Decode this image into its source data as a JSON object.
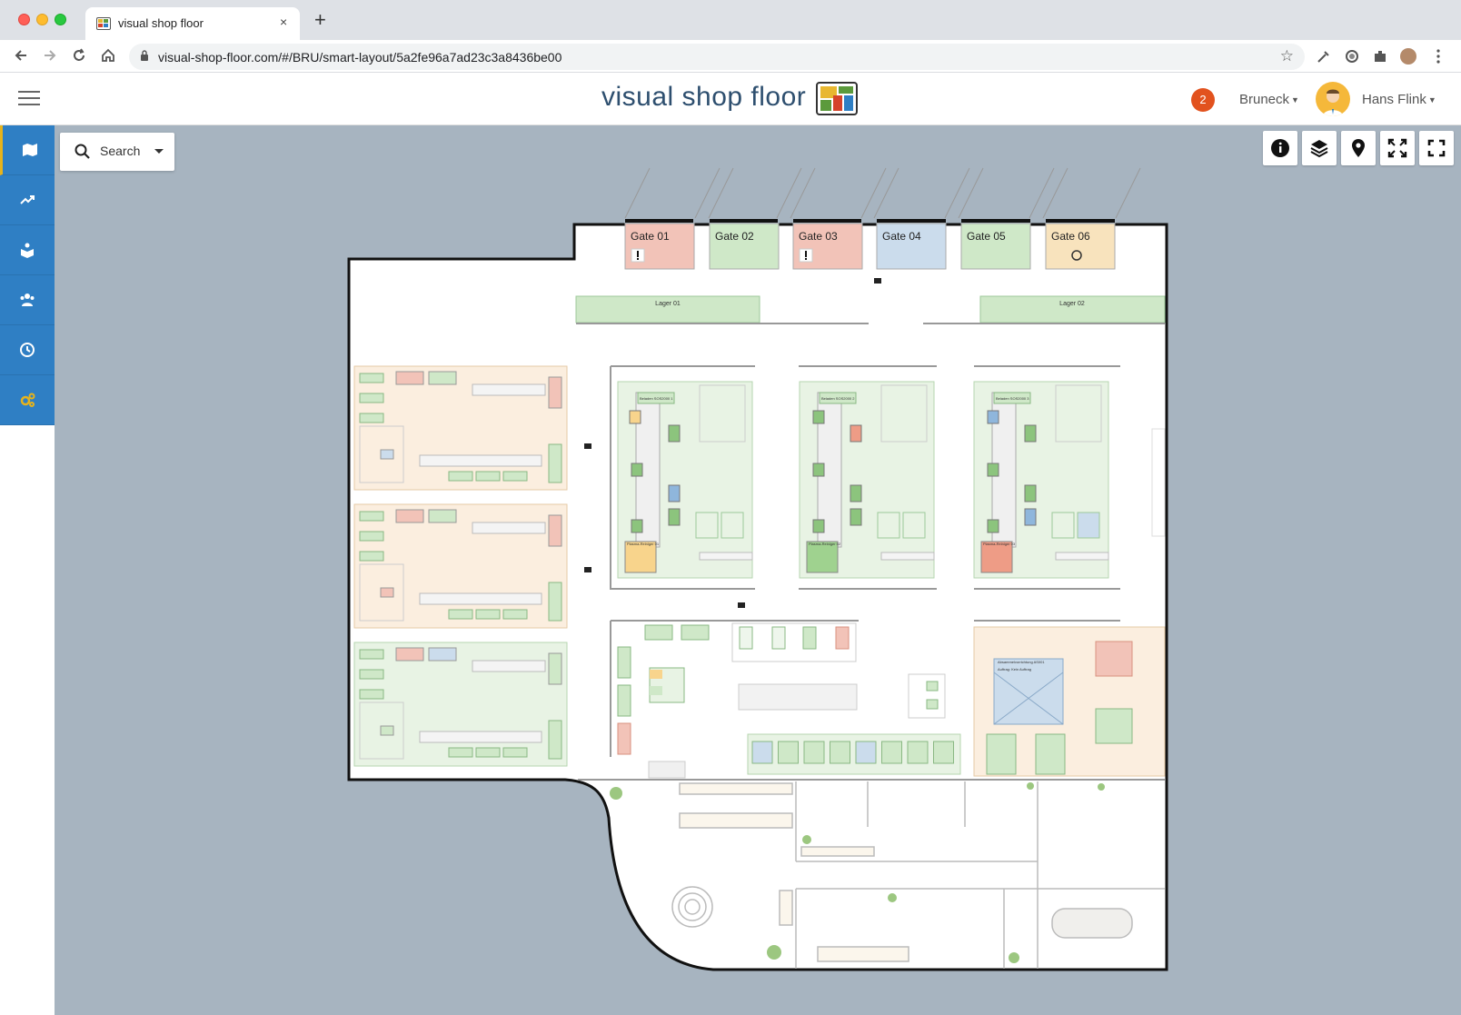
{
  "browser": {
    "tab_title": "visual shop floor",
    "tab_close": "×",
    "new_tab": "+",
    "url": "visual-shop-floor.com/#/BRU/smart-layout/5a2fe96a7ad23c3a8436be00"
  },
  "header": {
    "brand": "visual shop floor",
    "notification_count": "2",
    "location": "Bruneck",
    "user_name": "Hans Flink"
  },
  "sidebar": {
    "items": [
      {
        "icon": "map-icon",
        "active": true
      },
      {
        "icon": "trend-chart-icon",
        "active": false
      },
      {
        "icon": "book-reader-icon",
        "active": false
      },
      {
        "icon": "users-icon",
        "active": false
      },
      {
        "icon": "clock-icon",
        "active": false
      },
      {
        "icon": "gears-icon",
        "active": false
      }
    ]
  },
  "search": {
    "label": "Search"
  },
  "toolbar": {
    "items": [
      "info-icon",
      "layers-icon",
      "location-pin-icon",
      "fit-view-icon",
      "fullscreen-icon"
    ]
  },
  "floor": {
    "gates": [
      {
        "label": "Gate 01",
        "status": "alert",
        "color": "#f2c3b8"
      },
      {
        "label": "Gate 02",
        "status": "ok",
        "color": "#cfe8c8"
      },
      {
        "label": "Gate 03",
        "status": "alert",
        "color": "#f2c3b8"
      },
      {
        "label": "Gate 04",
        "status": "ok",
        "color": "#cbdcec"
      },
      {
        "label": "Gate 05",
        "status": "ok",
        "color": "#cfe8c8"
      },
      {
        "label": "Gate 06",
        "status": "sync",
        "color": "#f8e3bd"
      }
    ],
    "storage": [
      {
        "label": "Lager 01"
      },
      {
        "label": "Lager 02"
      }
    ],
    "production_cells": [
      {
        "label": "Beladen SOS2000 1",
        "washer": "Plasma-Reiniger 01"
      },
      {
        "label": "Beladen SOS2000 2",
        "washer": "Plasma-Reiniger 02"
      },
      {
        "label": "Beladen SOS2000 3",
        "washer": "Plasma-Reiniger 03"
      }
    ],
    "assembly_station": {
      "label": "Absammelvorrichtung AS001",
      "sub": "Auftrag: Kein Auftrag"
    }
  },
  "colors": {
    "accent": "#2f7fc4",
    "sidebar_active": "#e6b31c",
    "badge": "#e2521e",
    "map_bg": "#a7b4c0",
    "zone_green": "#cfe8c8",
    "zone_red": "#f2c3b8",
    "zone_blue": "#cbdcec",
    "zone_orange": "#f8e3bd"
  }
}
